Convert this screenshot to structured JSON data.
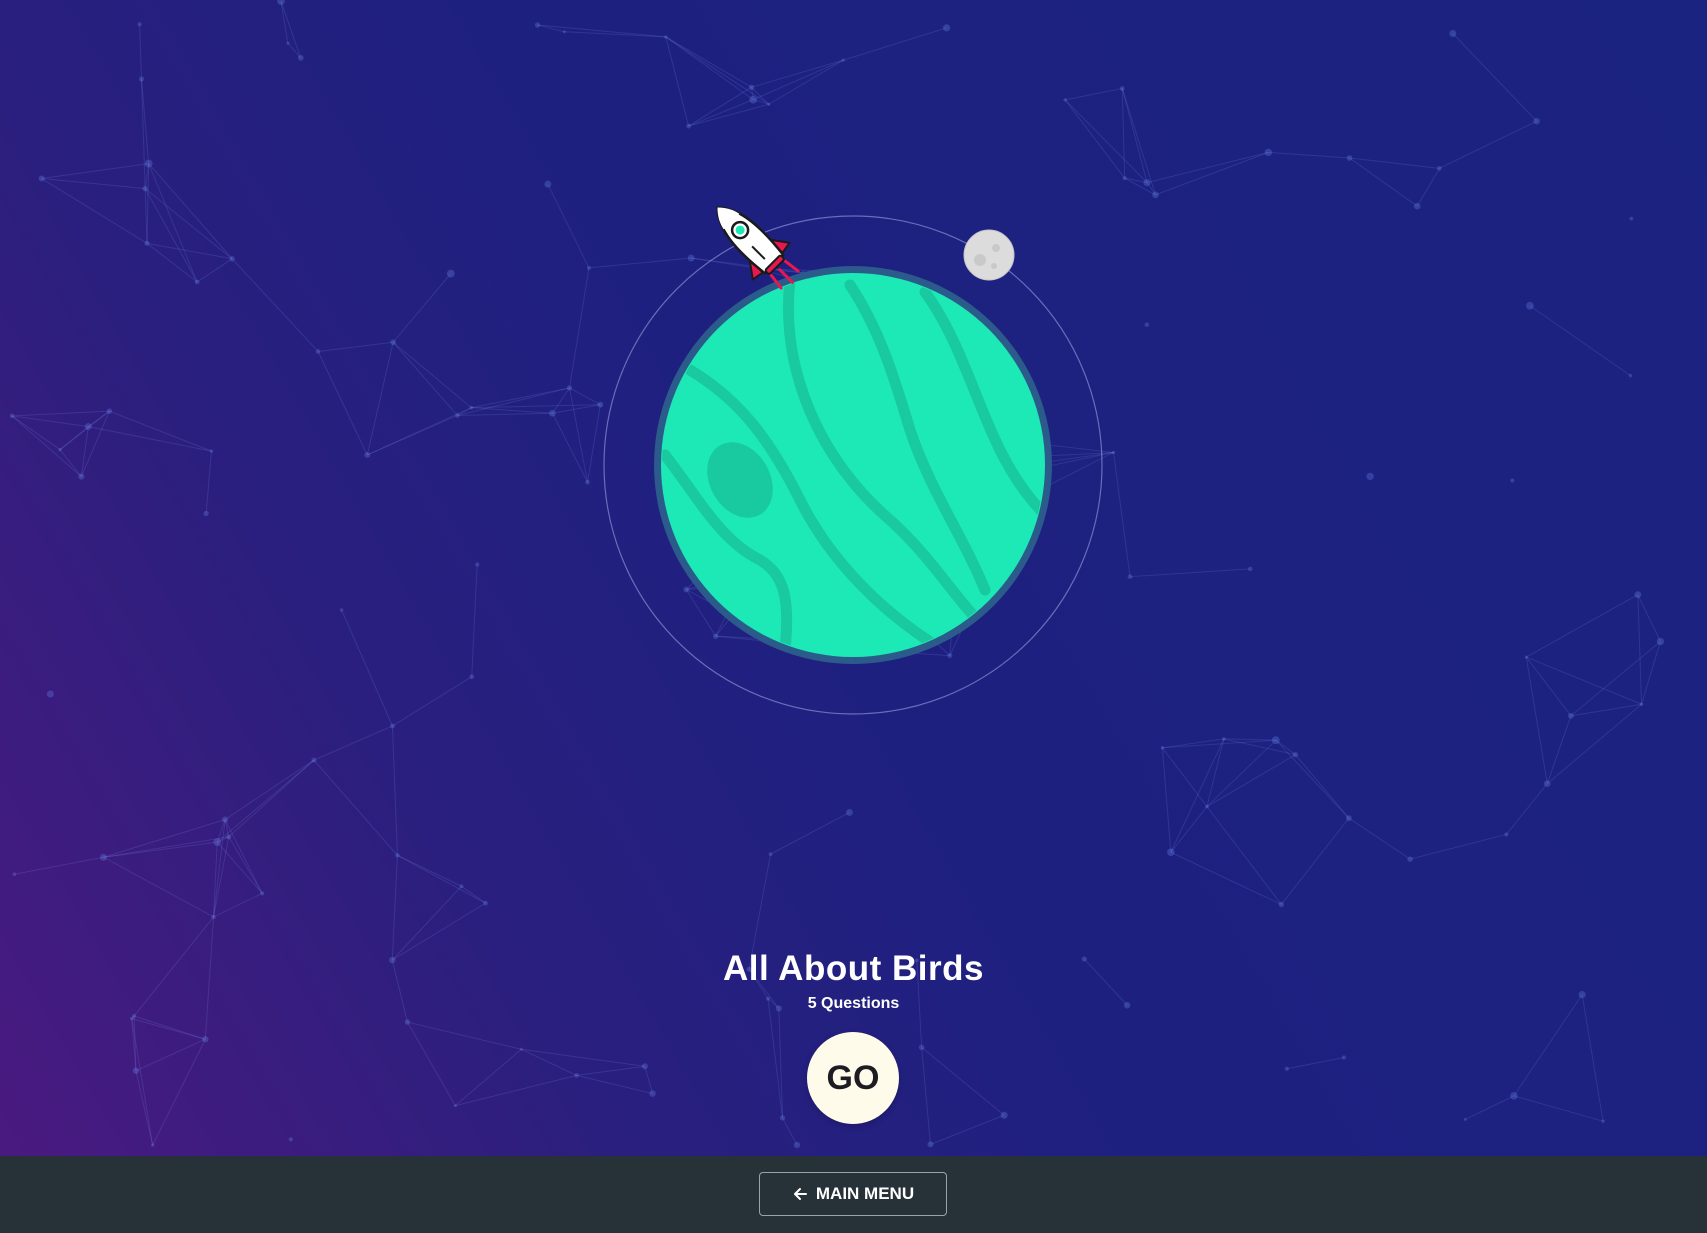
{
  "quiz": {
    "title": "All About Birds",
    "question_count": "5 Questions",
    "go_label": "GO"
  },
  "footer": {
    "main_menu_label": "MAIN MENU",
    "main_menu_icon": "arrow-left-icon"
  },
  "colors": {
    "planet": "#1de9b6",
    "planet_stripes": "#19c9a0",
    "planet_rim": "#2b5b8a",
    "footer_bg": "#263238",
    "go_button_bg": "#fffbea",
    "background_top": "#1b2380",
    "background_bottom_left": "#4a1a80"
  },
  "illustration": {
    "planet": "planet-icon",
    "moon": "moon-icon",
    "rocket": "rocket-icon"
  }
}
